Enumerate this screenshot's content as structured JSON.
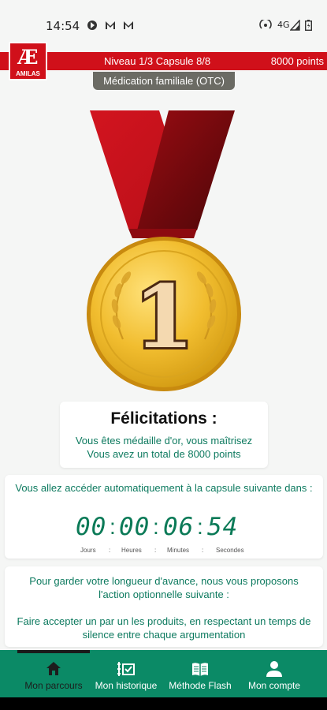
{
  "status_bar": {
    "time": "14:54",
    "network": "4G"
  },
  "header": {
    "logo_mark": "Æ",
    "logo_name": "AMILAS",
    "level_text": "Niveau 1/3 Capsule 8/8",
    "points_text": "8000 points",
    "category": "Médication familiale (OTC)"
  },
  "medal": {
    "number": "1"
  },
  "congrats_card": {
    "title": "Félicitations :",
    "line1": "Vous êtes médaille d'or, vous maîtrisez",
    "line2": "Vous avez un total de 8000 points"
  },
  "countdown_card": {
    "message": "Vous allez accéder automatiquement à la capsule suivante dans :",
    "days": "00",
    "hours": "00",
    "minutes": "06",
    "seconds": "54",
    "label_days": "Jours",
    "label_hours": "Heures",
    "label_minutes": "Minutes",
    "label_seconds": "Secondes"
  },
  "advice_card": {
    "intro": "Pour garder votre longueur d'avance, nous vous proposons l'action optionnelle suivante :",
    "action": "Faire accepter un par un les produits, en respectant un temps de silence entre chaque argumentation"
  },
  "bottom_nav": {
    "items": [
      {
        "label": "Mon parcours",
        "icon": "home-icon",
        "active": true
      },
      {
        "label": "Mon historique",
        "icon": "checklist-icon",
        "active": false
      },
      {
        "label": "Méthode Flash",
        "icon": "book-icon",
        "active": false
      },
      {
        "label": "Mon compte",
        "icon": "person-icon",
        "active": false
      }
    ]
  },
  "colors": {
    "brand_red": "#d0101a",
    "brand_green": "#0b8a66",
    "text_green": "#0d7a5f",
    "gold": "#e8b524"
  }
}
